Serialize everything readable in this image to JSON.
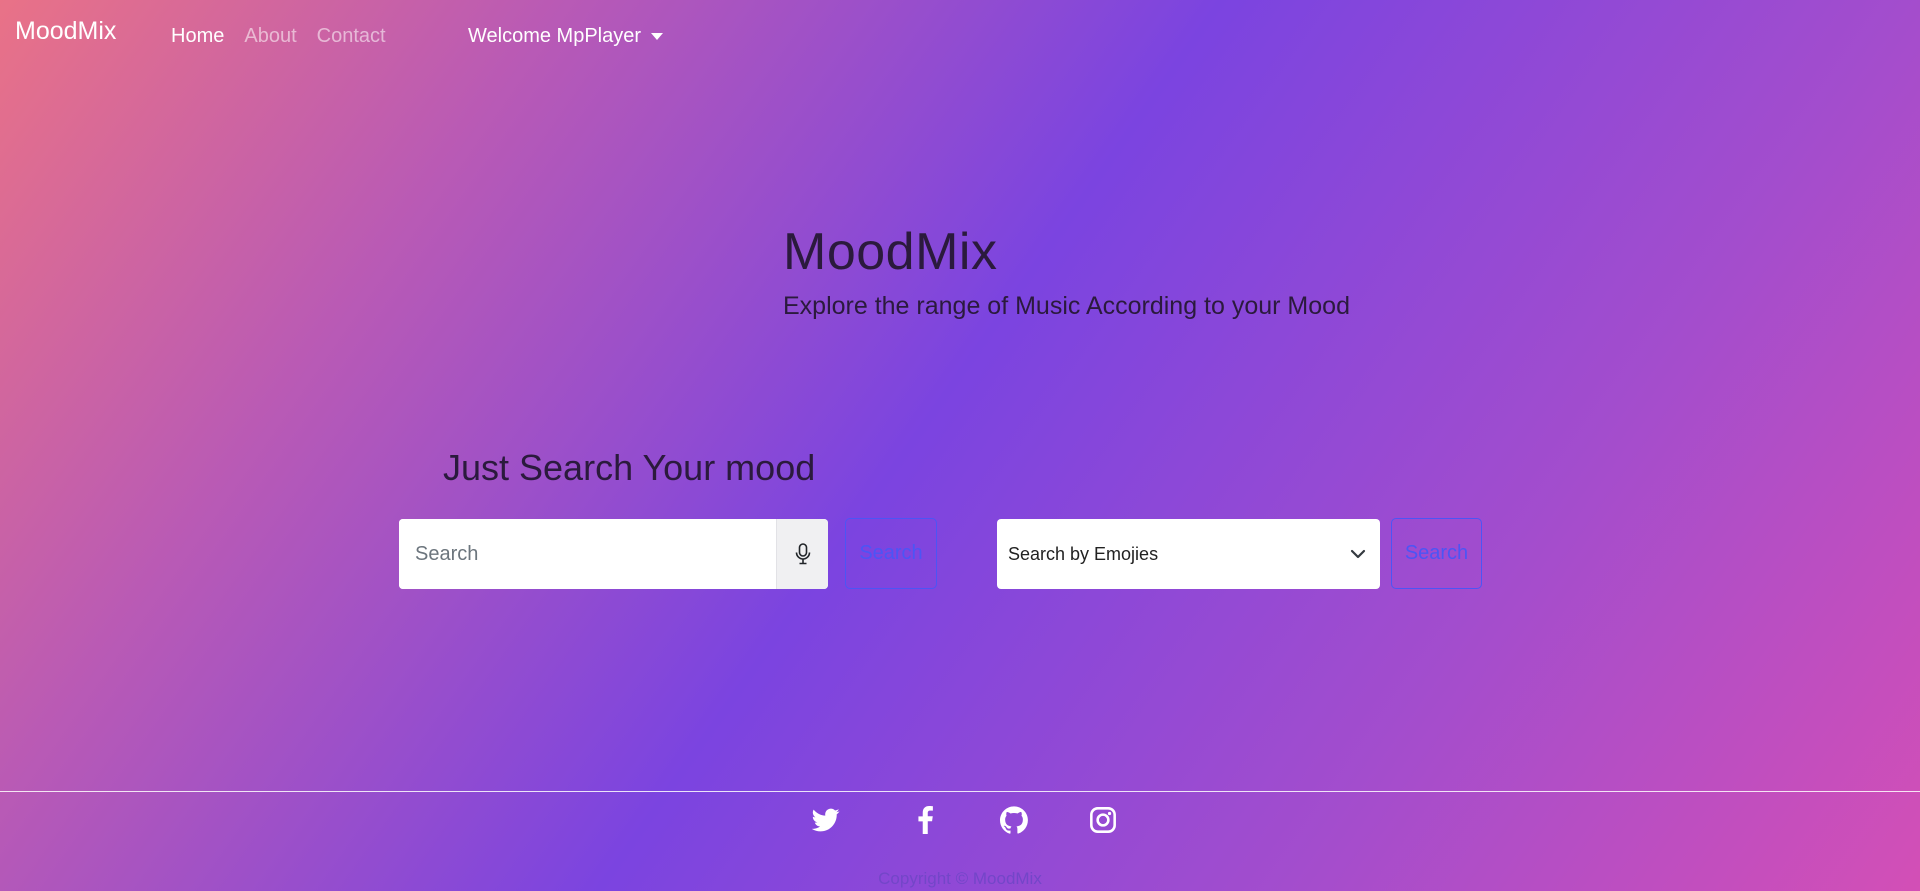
{
  "navbar": {
    "brand": "MoodMix",
    "links": [
      {
        "label": "Home",
        "active": true
      },
      {
        "label": "About",
        "active": false
      },
      {
        "label": "Contact",
        "active": false
      }
    ],
    "user_menu": "Welcome MpPlayer"
  },
  "hero": {
    "title": "MoodMix",
    "subtitle": "Explore the range of Music According to your Mood"
  },
  "search": {
    "heading": "Just Search Your mood",
    "placeholder": "Search",
    "button_label": "Search",
    "emoji_select_value": "Search by Emojies",
    "emoji_button_label": "Search"
  },
  "footer": {
    "icons": [
      "twitter-icon",
      "facebook-icon",
      "github-icon",
      "instagram-icon"
    ],
    "copyright": "Copyright © MoodMix"
  },
  "colors": {
    "accent": "#4c55f5",
    "heading_text": "#2b1a3d"
  }
}
